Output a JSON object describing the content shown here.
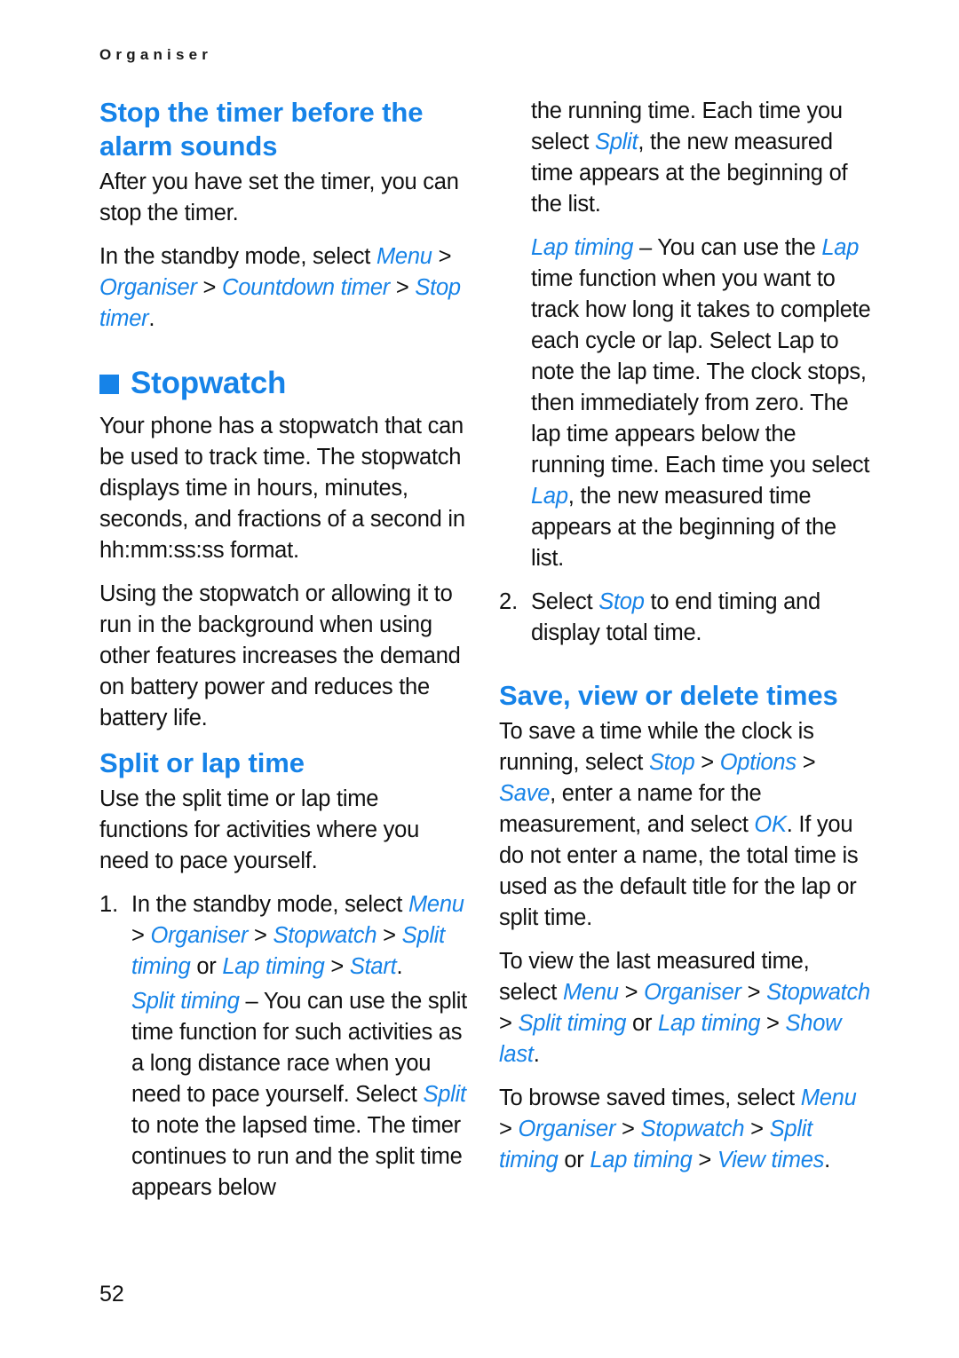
{
  "page": {
    "running_header": "Organiser",
    "page_number": "52",
    "accent_color": "#1683e8",
    "text_color": "#111111",
    "background_color": "#ffffff"
  },
  "left_column": {
    "heading_1": "Stop the timer before the alarm sounds",
    "para_1": "After you have set the timer, you can stop the timer.",
    "para_2_lead": "In the standby mode, select ",
    "para_2_menu": "Menu",
    "para_2_sep1": " > ",
    "para_2_organiser": "Organiser",
    "para_2_sep2": " > ",
    "para_2_countdown": "Countdown timer",
    "para_2_sep3": " > ",
    "para_2_stoptimer": "Stop timer",
    "para_2_end": ".",
    "chapter_heading": "Stopwatch",
    "para_3": "Your phone has a stopwatch that can be used to track time. The stopwatch displays time in hours, minutes, seconds, and fractions of a second in hh:mm:ss:ss format.",
    "para_4": "Using the stopwatch or allowing it to run in the background when using other features increases the demand on battery power and reduces the battery life.",
    "heading_2": "Split or lap time",
    "para_5": "Use the split time or lap time functions for activities where you need to pace yourself.",
    "list_item_1_number": "1.",
    "list_item_1_lead": "In the standby mode, select ",
    "list_item_1_menu": "Menu",
    "list_item_1_sep1": " > ",
    "list_item_1_organiser": "Organiser",
    "list_item_1_sep2": " > ",
    "list_item_1_stopwatch": "Stopwatch",
    "list_item_1_sep3": " > ",
    "list_item_1_split": "Split timing",
    "list_item_1_or": " or ",
    "list_item_1_lap": "Lap timing",
    "list_item_1_sep4": " > ",
    "list_item_1_start": "Start",
    "list_item_1_end": ".",
    "split_timing_term": "Split timing",
    "split_timing_dash": " – ",
    "split_timing_body_1": "You can use the split time function for such activities as a long distance race when you need to pace yourself. Select ",
    "split_timing_split": "Split",
    "split_timing_body_2": " to note the lapsed time. The timer continues to run and the split time appears below"
  },
  "right_column": {
    "split_timing_cont_1": "the running time. Each time you select ",
    "split_timing_cont_split": "Split",
    "split_timing_cont_2": ", the new measured time appears at the beginning of the list.",
    "lap_timing_term": "Lap timing",
    "lap_timing_dash": " – ",
    "lap_timing_body_1": "You can use the ",
    "lap_timing_lap": "Lap",
    "lap_timing_body_2": " time function when you want to track how long it takes to complete each cycle or lap. Select Lap to note the lap time. The clock stops, then immediately from zero. The lap time appears below the running time. Each time you select ",
    "lap_timing_lap_2": "Lap",
    "lap_timing_body_3": ", the new measured time appears at the beginning of the list.",
    "list_item_2_number": "2.",
    "list_item_2_lead": "Select ",
    "list_item_2_stop": "Stop",
    "list_item_2_end": " to end timing and display total time.",
    "heading_3": "Save, view or delete times",
    "para_save_1": "To save a time while the clock is running, select ",
    "para_save_stop": "Stop",
    "para_save_sep1": " > ",
    "para_save_options": "Options",
    "para_save_sep2": " > ",
    "para_save_save": "Save",
    "para_save_2": ", enter a name for the measurement, and select ",
    "para_save_ok": "OK",
    "para_save_3": ". If you do not enter a name, the total time is used as the default title for the lap or split time.",
    "para_view_1": "To view the last measured time, select ",
    "para_view_menu": "Menu",
    "para_view_sep1": " > ",
    "para_view_organiser": "Organiser",
    "para_view_sep2": " > ",
    "para_view_stopwatch": "Stopwatch",
    "para_view_sep3": " > ",
    "para_view_split": "Split timing",
    "para_view_or": " or ",
    "para_view_lap": "Lap timing",
    "para_view_sep4": " > ",
    "para_view_showlast": "Show last",
    "para_view_end": ".",
    "para_browse_1": "To browse saved times, select ",
    "para_browse_menu": "Menu",
    "para_browse_sep1": " > ",
    "para_browse_organiser": "Organiser",
    "para_browse_sep2": " > ",
    "para_browse_stopwatch": "Stopwatch",
    "para_browse_sep3": " > ",
    "para_browse_split": "Split timing",
    "para_browse_or": " or ",
    "para_browse_lap": "Lap timing",
    "para_browse_sep4": " > ",
    "para_browse_view": "View times",
    "para_browse_end": "."
  }
}
